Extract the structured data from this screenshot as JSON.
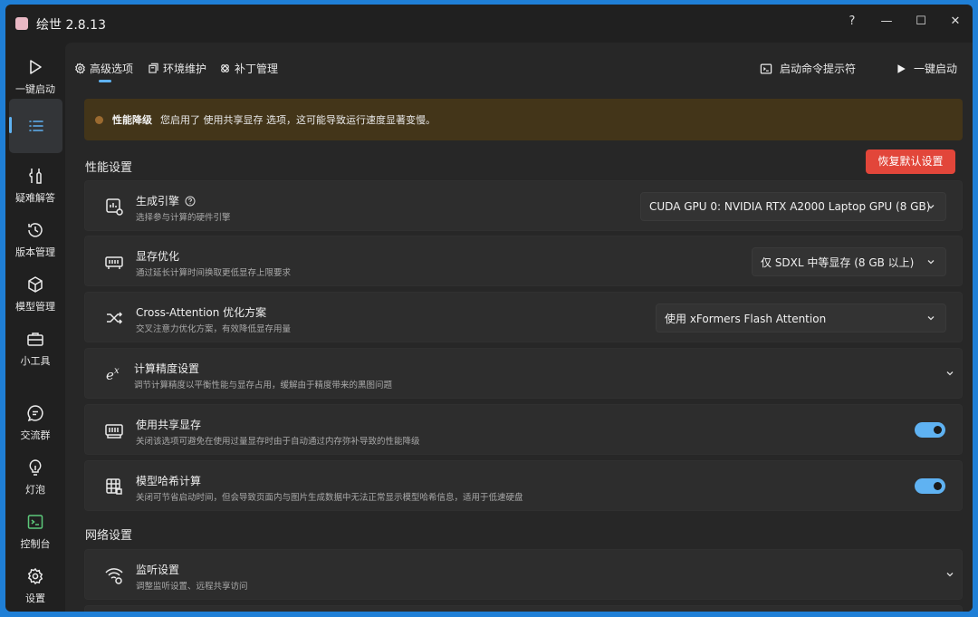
{
  "app": {
    "title": "绘世 2.8.13"
  },
  "window_controls": {
    "help": "?",
    "minimize": "—",
    "maximize": "☐",
    "close": "✕"
  },
  "sidebar": {
    "items": [
      {
        "label": "一键启动",
        "icon": "play-icon"
      },
      {
        "label": "",
        "icon": "list-icon",
        "active": true
      },
      {
        "label": "疑难解答",
        "icon": "tools-icon"
      },
      {
        "label": "版本管理",
        "icon": "history-icon"
      },
      {
        "label": "模型管理",
        "icon": "cube-icon"
      },
      {
        "label": "小工具",
        "icon": "toolbox-icon"
      },
      {
        "label": "交流群",
        "icon": "chat-icon"
      },
      {
        "label": "灯泡",
        "icon": "bulb-icon"
      },
      {
        "label": "控制台",
        "icon": "console-icon"
      },
      {
        "label": "设置",
        "icon": "gear-icon"
      }
    ]
  },
  "tabs": [
    {
      "label": "高级选项",
      "icon": "settings-icon",
      "active": true
    },
    {
      "label": "环境维护",
      "icon": "package-icon"
    },
    {
      "label": "补丁管理",
      "icon": "patch-icon"
    }
  ],
  "top_actions": {
    "cmd_hint": "启动命令提示符",
    "launch": "一键启动"
  },
  "banner": {
    "title": "性能降级",
    "message": "您启用了 使用共享显存 选项，这可能导致运行速度显著变慢。"
  },
  "performance": {
    "section_title": "性能设置",
    "reset_label": "恢复默认设置",
    "engine": {
      "title": "生成引擎",
      "desc": "选择参与计算的硬件引擎",
      "value": "CUDA GPU 0: NVIDIA RTX A2000 Laptop GPU (8 GB)"
    },
    "vram": {
      "title": "显存优化",
      "desc": "通过延长计算时间换取更低显存上限要求",
      "value": "仅 SDXL 中等显存 (8 GB 以上)"
    },
    "attention": {
      "title": "Cross-Attention 优化方案",
      "desc": "交叉注意力优化方案，有效降低显存用量",
      "value": "使用 xFormers Flash Attention"
    },
    "precision": {
      "title": "计算精度设置",
      "desc": "调节计算精度以平衡性能与显存占用，缓解由于精度带来的黑图问题"
    },
    "shared_vram": {
      "title": "使用共享显存",
      "desc": "关闭该选项可避免在使用过量显存时由于自动通过内存弥补导致的性能降级",
      "enabled": true
    },
    "model_hash": {
      "title": "模型哈希计算",
      "desc": "关闭可节省启动时间，但会导致页面内与图片生成数据中无法正常显示模型哈希信息，适用于低速硬盘",
      "enabled": true
    }
  },
  "network": {
    "section_title": "网络设置",
    "listen": {
      "title": "监听设置",
      "desc": "调整监听设置、远程共享访问"
    }
  },
  "colors": {
    "accent": "#5fb2f2",
    "danger": "#e2463a",
    "warning_bg": "#433519"
  }
}
